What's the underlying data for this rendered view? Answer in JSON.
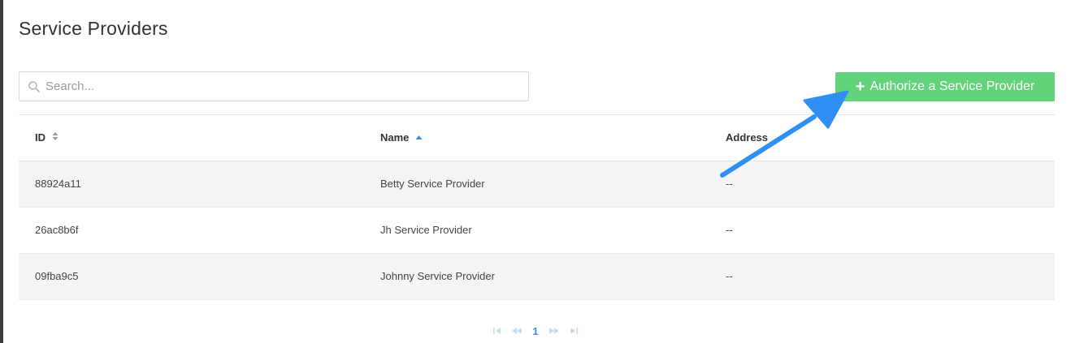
{
  "page": {
    "title": "Service Providers"
  },
  "search": {
    "placeholder": "Search...",
    "value": ""
  },
  "actions": {
    "authorize_label": "Authorize a Service Provider",
    "authorize_color": "#63d37b"
  },
  "table": {
    "columns": [
      {
        "label": "ID",
        "sort": "sortable"
      },
      {
        "label": "Name",
        "sort": "ascending"
      },
      {
        "label": "Address",
        "sort": "none"
      }
    ],
    "rows": [
      {
        "id": "88924a11",
        "name": "Betty Service Provider",
        "address": "--"
      },
      {
        "id": "26ac8b6f",
        "name": "Jh Service Provider",
        "address": "--"
      },
      {
        "id": "09fba9c5",
        "name": "Johnny Service Provider",
        "address": "--"
      }
    ]
  },
  "pagination": {
    "current_page": "1",
    "active_color": "#3b8fd9"
  },
  "annotation": {
    "arrow_color": "#2f8ff5"
  }
}
